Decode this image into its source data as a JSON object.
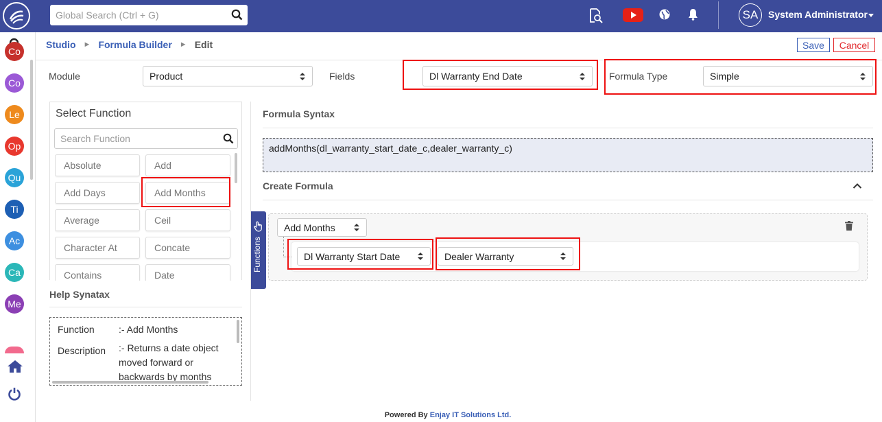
{
  "header": {
    "search_placeholder": "Global Search (Ctrl + G)",
    "user_initials": "SA",
    "user_name": "System Administrator"
  },
  "sidebar": {
    "modules": [
      {
        "abbr": "Co",
        "color": "#c6312c"
      },
      {
        "abbr": "Co",
        "color": "#9b59d6"
      },
      {
        "abbr": "Le",
        "color": "#ee8a1d"
      },
      {
        "abbr": "Op",
        "color": "#e8382e"
      },
      {
        "abbr": "Qu",
        "color": "#2aa3d8"
      },
      {
        "abbr": "Ti",
        "color": "#1d5fb4"
      },
      {
        "abbr": "Ac",
        "color": "#3d8fe0"
      },
      {
        "abbr": "Ca",
        "color": "#2bb7b8"
      },
      {
        "abbr": "Me",
        "color": "#8b3fb4"
      }
    ]
  },
  "breadcrumb": {
    "studio": "Studio",
    "formula_builder": "Formula Builder",
    "current": "Edit"
  },
  "actions": {
    "save": "Save",
    "cancel": "Cancel"
  },
  "form": {
    "module_label": "Module",
    "module_value": "Product",
    "fields_label": "Fields",
    "fields_value": "Dl Warranty End Date",
    "formula_type_label": "Formula Type",
    "formula_type_value": "Simple"
  },
  "select_function": {
    "title": "Select Function",
    "search_placeholder": "Search Function",
    "functions": [
      "Absolute",
      "Add",
      "Add Days",
      "Add Months",
      "Average",
      "Ceil",
      "Character At",
      "Concate",
      "Contains",
      "Date"
    ]
  },
  "help": {
    "title": "Help Synatax",
    "function_key": "Function",
    "function_value": ":- Add Months",
    "description_key": "Description",
    "description_value": ":- Returns a date object moved forward or backwards by months"
  },
  "functions_tab": "Functions",
  "syntax": {
    "title": "Formula Syntax",
    "text": "addMonths(dl_warranty_start_date_c,dealer_warranty_c)"
  },
  "create": {
    "title": "Create Formula",
    "function_select": "Add Months",
    "arg1": "Dl Warranty Start Date",
    "arg2": "Dealer Warranty"
  },
  "footer": {
    "prefix": "Powered By",
    "company": "Enjay IT Solutions Ltd."
  }
}
